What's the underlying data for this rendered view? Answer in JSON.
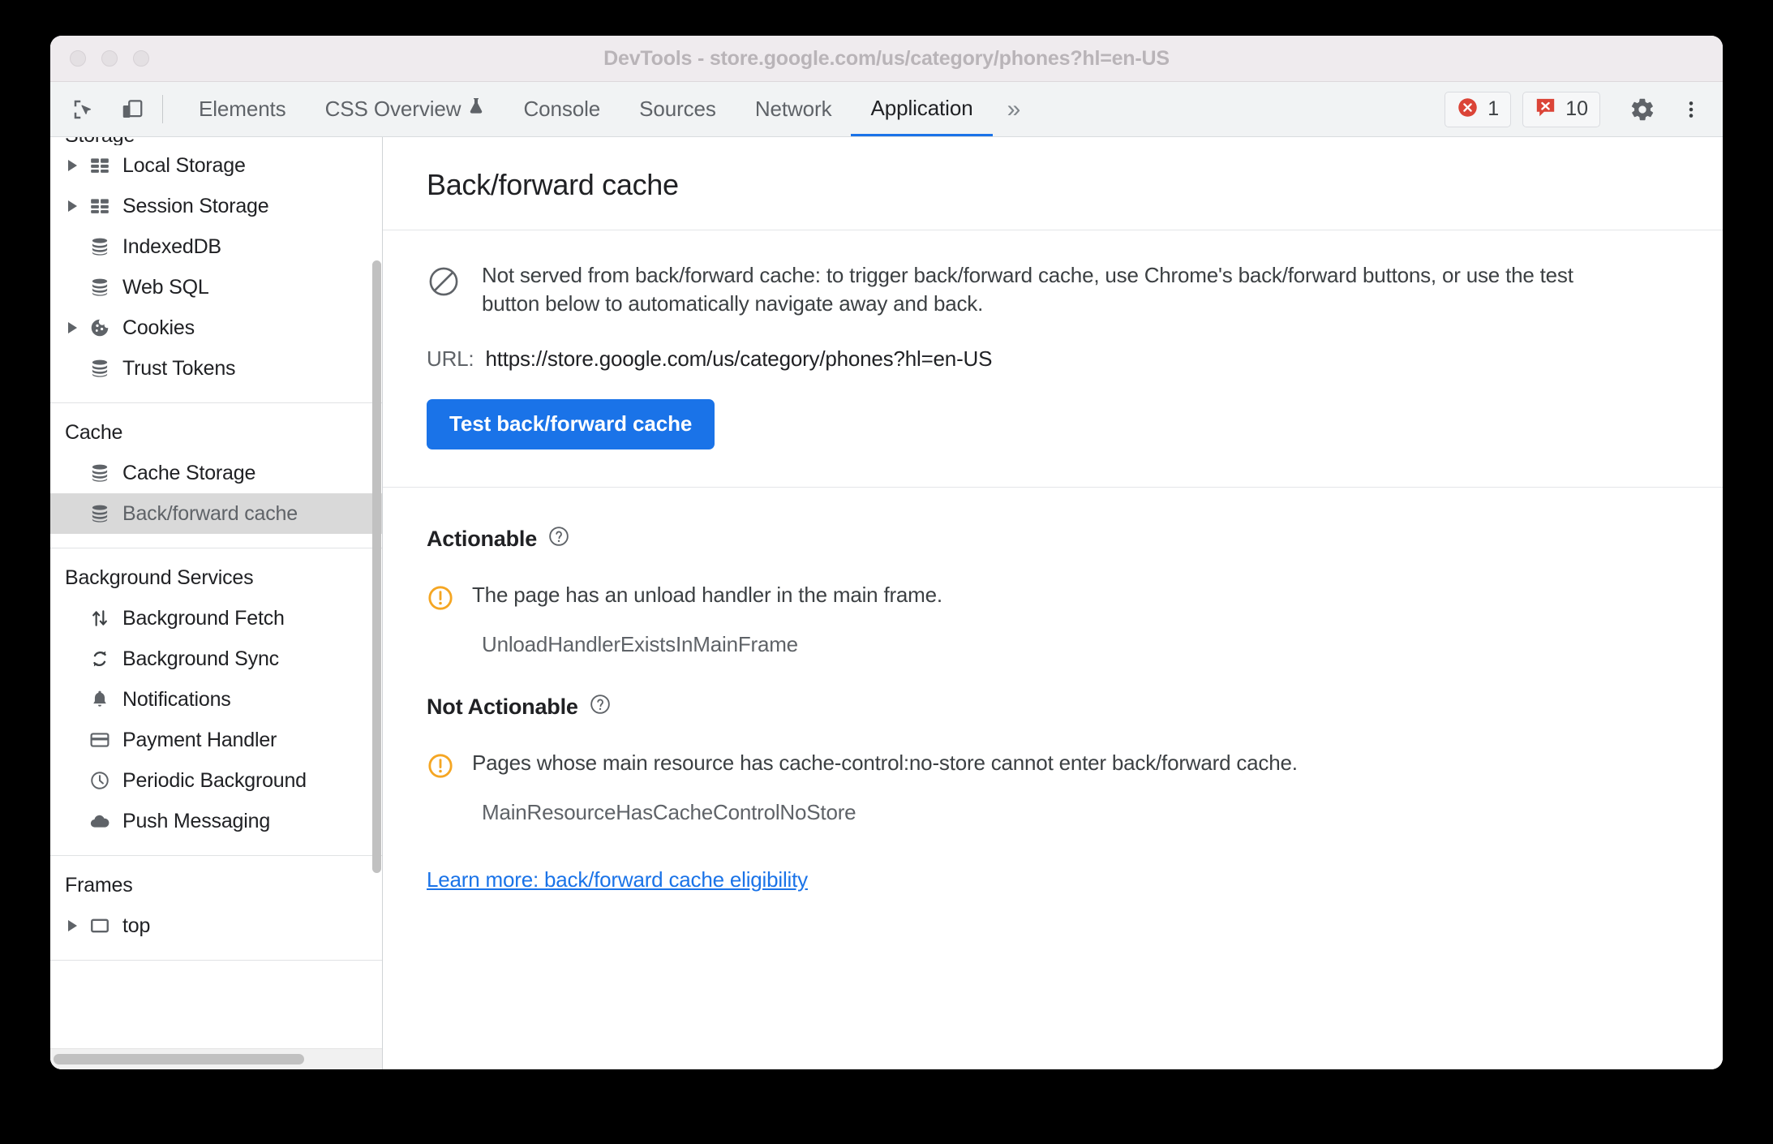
{
  "window": {
    "title": "DevTools - store.google.com/us/category/phones?hl=en-US"
  },
  "toolbar": {
    "inspect_icon": "inspect-cursor-icon",
    "device_icon": "device-toolbar-icon",
    "tabs": [
      {
        "label": "Elements",
        "selected": false,
        "icon": null
      },
      {
        "label": "CSS Overview",
        "selected": false,
        "icon": "flask-icon"
      },
      {
        "label": "Console",
        "selected": false,
        "icon": null
      },
      {
        "label": "Sources",
        "selected": false,
        "icon": null
      },
      {
        "label": "Network",
        "selected": false,
        "icon": null
      },
      {
        "label": "Application",
        "selected": true,
        "icon": null
      }
    ],
    "more_tabs_label": "»",
    "errors_count": "1",
    "issues_count": "10",
    "settings_icon": "gear-icon",
    "menu_icon": "kebab-menu-icon",
    "accent_color": "#1a73e8",
    "error_color": "#db4437"
  },
  "sidebar": {
    "groups": [
      {
        "title": "Storage",
        "title_clipped": true,
        "items": [
          {
            "label": "Local Storage",
            "icon": "table-storage-icon",
            "expandable": true,
            "selected": false
          },
          {
            "label": "Session Storage",
            "icon": "table-storage-icon",
            "expandable": true,
            "selected": false
          },
          {
            "label": "IndexedDB",
            "icon": "database-icon",
            "expandable": false,
            "selected": false
          },
          {
            "label": "Web SQL",
            "icon": "database-icon",
            "expandable": false,
            "selected": false
          },
          {
            "label": "Cookies",
            "icon": "cookie-icon",
            "expandable": true,
            "selected": false
          },
          {
            "label": "Trust Tokens",
            "icon": "database-icon",
            "expandable": false,
            "selected": false
          }
        ]
      },
      {
        "title": "Cache",
        "title_clipped": false,
        "items": [
          {
            "label": "Cache Storage",
            "icon": "database-icon",
            "expandable": false,
            "selected": false
          },
          {
            "label": "Back/forward cache",
            "icon": "database-icon",
            "expandable": false,
            "selected": true
          }
        ]
      },
      {
        "title": "Background Services",
        "title_clipped": false,
        "items": [
          {
            "label": "Background Fetch",
            "icon": "up-down-arrows-icon",
            "expandable": false,
            "selected": false
          },
          {
            "label": "Background Sync",
            "icon": "sync-icon",
            "expandable": false,
            "selected": false
          },
          {
            "label": "Notifications",
            "icon": "bell-icon",
            "expandable": false,
            "selected": false
          },
          {
            "label": "Payment Handler",
            "icon": "credit-card-icon",
            "expandable": false,
            "selected": false
          },
          {
            "label": "Periodic Background",
            "icon": "clock-icon",
            "expandable": false,
            "selected": false
          },
          {
            "label": "Push Messaging",
            "icon": "cloud-icon",
            "expandable": false,
            "selected": false
          }
        ]
      },
      {
        "title": "Frames",
        "title_clipped": false,
        "items": [
          {
            "label": "top",
            "icon": "frame-icon",
            "expandable": true,
            "selected": false
          }
        ]
      }
    ]
  },
  "main": {
    "page_title": "Back/forward cache",
    "status": {
      "icon": "blocked-icon",
      "message": "Not served from back/forward cache: to trigger back/forward cache, use Chrome's back/forward buttons, or use the test button below to automatically navigate away and back.",
      "url_label": "URL:",
      "url_value": "https://store.google.com/us/category/phones?hl=en-US",
      "test_button_label": "Test back/forward cache"
    },
    "sections": [
      {
        "heading": "Actionable",
        "help_icon": "help-circle-icon",
        "issues": [
          {
            "icon": "warning-circle-icon",
            "text": "The page has an unload handler in the main frame.",
            "code": "UnloadHandlerExistsInMainFrame"
          }
        ]
      },
      {
        "heading": "Not Actionable",
        "help_icon": "help-circle-icon",
        "issues": [
          {
            "icon": "warning-circle-icon",
            "text": "Pages whose main resource has cache-control:no-store cannot enter back/forward cache.",
            "code": "MainResourceHasCacheControlNoStore"
          }
        ]
      }
    ],
    "learn_more_link": "Learn more: back/forward cache eligibility",
    "warning_color": "#f5a623",
    "link_color": "#1a73e8"
  }
}
